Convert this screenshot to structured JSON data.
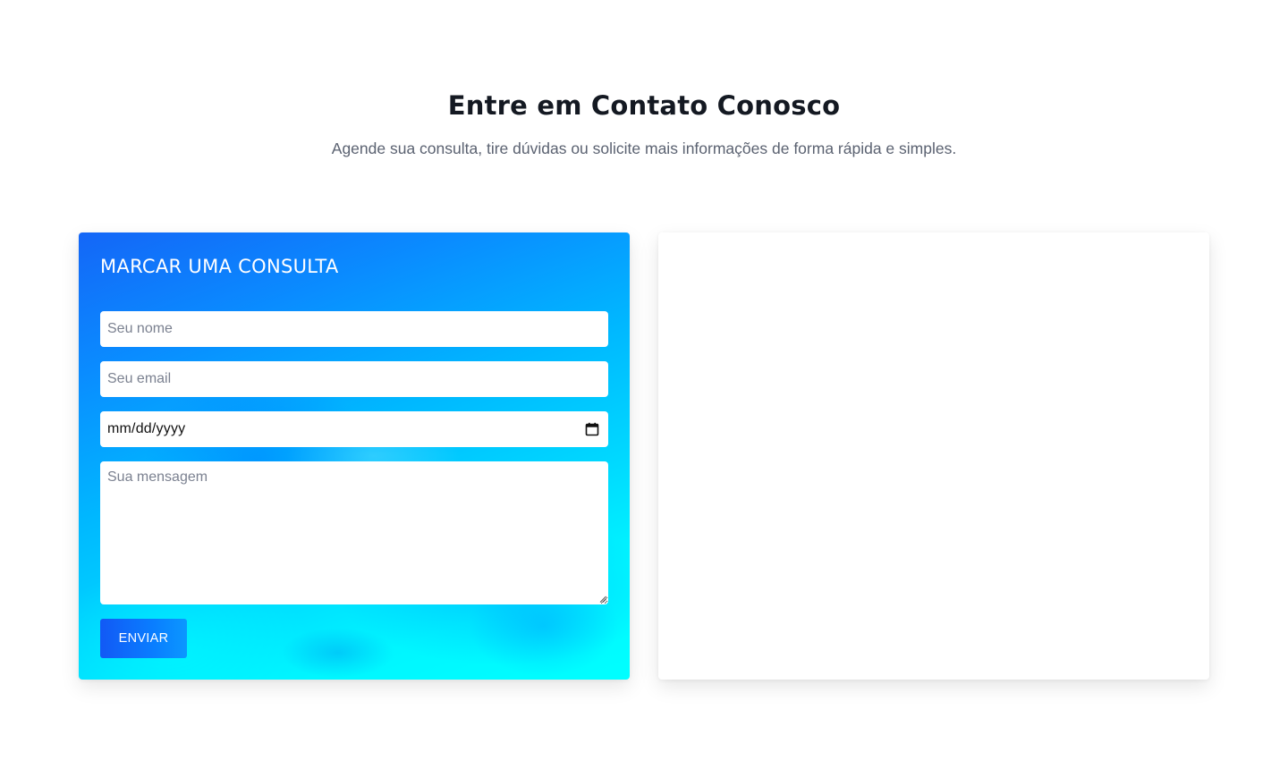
{
  "header": {
    "title": "Entre em Contato Conosco",
    "subtitle": "Agende sua consulta, tire dúvidas ou solicite mais informações de forma rápida e simples."
  },
  "form": {
    "title": "MARCAR UMA CONSULTA",
    "name_placeholder": "Seu nome",
    "email_placeholder": "Seu email",
    "date_value": "mm/dd/yyyy",
    "date_icon": "calendar-icon",
    "message_placeholder": "Sua mensagem",
    "submit_label": "ENVIAR"
  },
  "colors": {
    "title": "#141922",
    "subtitle": "#5b6271",
    "gradient_start": "#1466f7",
    "gradient_end": "#00ffff",
    "button": "#1259f5",
    "card_background": "#ffffff"
  }
}
